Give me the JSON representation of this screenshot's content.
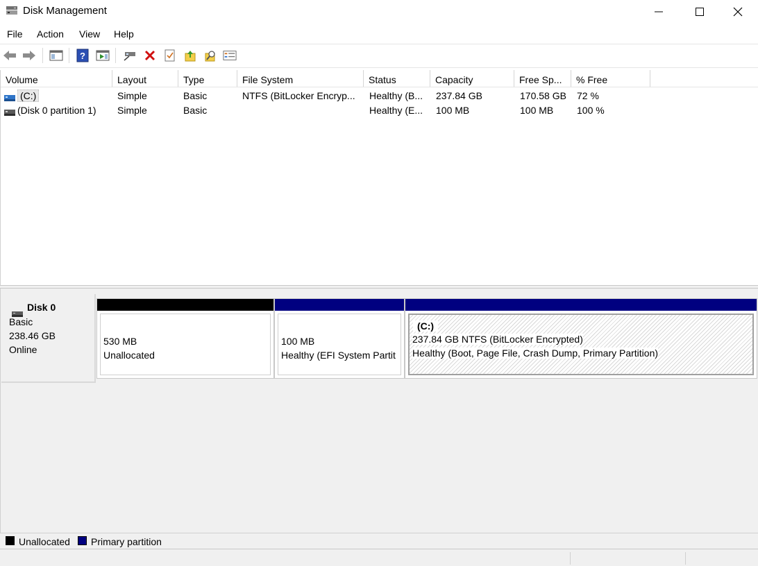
{
  "window": {
    "title": "Disk Management"
  },
  "menu": [
    "File",
    "Action",
    "View",
    "Help"
  ],
  "toolbar": {
    "icons": [
      "back-icon",
      "forward-icon",
      "show-hide-console-tree-icon",
      "help-icon",
      "show-action-pane-icon",
      "connect-disk-icon",
      "delete-icon",
      "checklist-icon",
      "up-folder-icon",
      "search-icon",
      "properties-icon"
    ]
  },
  "volume_list": {
    "columns": [
      "Volume",
      "Layout",
      "Type",
      "File System",
      "Status",
      "Capacity",
      "Free Sp...",
      "% Free"
    ],
    "rows": [
      {
        "volume": "(C:)",
        "layout": "Simple",
        "type": "Basic",
        "fs": "NTFS (BitLocker Encryp...",
        "status": "Healthy (B...",
        "capacity": "237.84 GB",
        "free": "170.58 GB",
        "pct": "72 %"
      },
      {
        "volume": "(Disk 0 partition 1)",
        "layout": "Simple",
        "type": "Basic",
        "fs": "",
        "status": "Healthy (E...",
        "capacity": "100 MB",
        "free": "100 MB",
        "pct": "100 %"
      }
    ]
  },
  "disk": {
    "name": "Disk 0",
    "type": "Basic",
    "size": "238.46 GB",
    "state": "Online",
    "partitions": [
      {
        "size": "530 MB",
        "status": "Unallocated",
        "bar_color": "#000000"
      },
      {
        "size": "100 MB",
        "status": "Healthy (EFI System Partit",
        "bar_color": "#000080"
      },
      {
        "label": "(C:)",
        "size": "237.84 GB NTFS (BitLocker Encrypted)",
        "status": "Healthy (Boot, Page File, Crash Dump, Primary Partition)",
        "bar_color": "#000080"
      }
    ]
  },
  "legend": [
    {
      "label": "Unallocated",
      "color": "#000000"
    },
    {
      "label": "Primary partition",
      "color": "#000080"
    }
  ]
}
